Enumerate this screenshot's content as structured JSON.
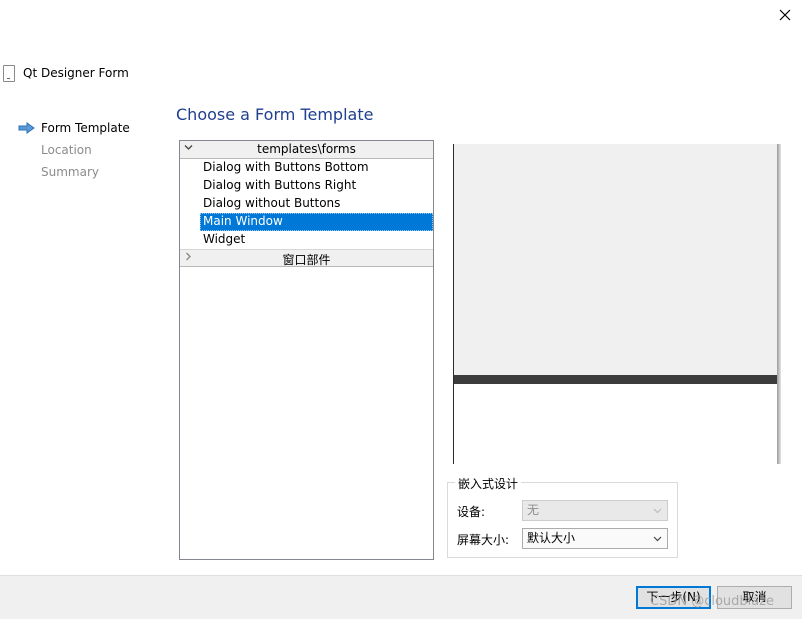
{
  "window": {
    "close_icon": "close-icon"
  },
  "wizard": {
    "title": "Qt Designer Form",
    "icon": "form-document-icon",
    "steps": [
      {
        "label": "Form Template",
        "current": true
      },
      {
        "label": "Location",
        "current": false
      },
      {
        "label": "Summary",
        "current": false
      }
    ],
    "current_step_icon": "right-arrow-icon"
  },
  "page": {
    "heading": "Choose a Form Template"
  },
  "tree": {
    "groups": [
      {
        "label": "templates\\forms",
        "expanded": true,
        "items": [
          {
            "label": "Dialog with Buttons Bottom",
            "selected": false
          },
          {
            "label": "Dialog with Buttons Right",
            "selected": false
          },
          {
            "label": "Dialog without Buttons",
            "selected": false
          },
          {
            "label": "Main Window",
            "selected": true
          },
          {
            "label": "Widget",
            "selected": false
          }
        ]
      },
      {
        "label": "窗口部件",
        "expanded": false,
        "items": []
      }
    ]
  },
  "embedded_design": {
    "title": "嵌入式设计",
    "device_label": "设备:",
    "device_value": "无",
    "device_enabled": false,
    "screen_size_label": "屏幕大小:",
    "screen_size_value": "默认大小"
  },
  "footer": {
    "next_label": "下一步(N)",
    "cancel_label": "取消",
    "watermark": "CSDN @cloudblaze"
  },
  "colors": {
    "accent": "#0078d7",
    "heading": "#1f3f8f",
    "disabled_text": "#8c8c8c"
  }
}
